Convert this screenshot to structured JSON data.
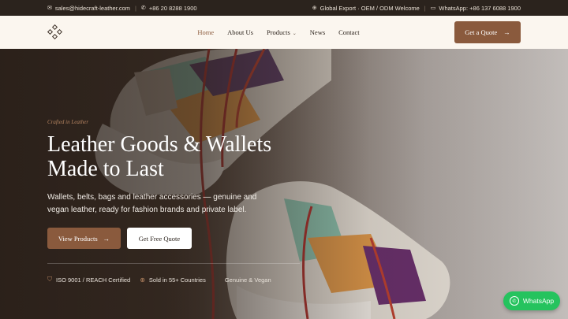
{
  "topbar": {
    "email": "sales@hidecraft-leather.com",
    "phone": "+86 20 8288 1900",
    "export_note": "Global Export · OEM / ODM Welcome",
    "whatsapp": "WhatsApp: +86 137 6088 1900",
    "icons": [
      "mail-icon",
      "phone-icon",
      "globe-icon",
      "chat-icon"
    ]
  },
  "nav": {
    "items": [
      {
        "label": "Home",
        "active": true
      },
      {
        "label": "About Us"
      },
      {
        "label": "Products",
        "has_dropdown": true
      },
      {
        "label": "News"
      },
      {
        "label": "Contact"
      }
    ],
    "cta": "Get a Quote"
  },
  "hero": {
    "eyebrow": "Crafted in Leather",
    "title_line1": "Leather Goods & Wallets",
    "title_line2": "Made to Last",
    "subtitle": "Wallets, belts, bags and leather accessories — genuine and vegan leather, ready for fashion brands and private label.",
    "primary_button": "View Products",
    "secondary_button": "Get Free Quote",
    "badges": [
      {
        "icon": "shield-icon",
        "label": "ISO 9001 / REACH Certified"
      },
      {
        "icon": "globe-icon",
        "label": "Sold in 55+ Countries"
      },
      {
        "icon": "",
        "label": "Genuine & Vegan"
      }
    ]
  },
  "floating": {
    "whatsapp_label": "WhatsApp"
  },
  "colors": {
    "accent": "#8a5a3d",
    "topbar_bg": "#2b231d",
    "nav_bg": "#fbf6ef",
    "whatsapp": "#25c35e"
  }
}
